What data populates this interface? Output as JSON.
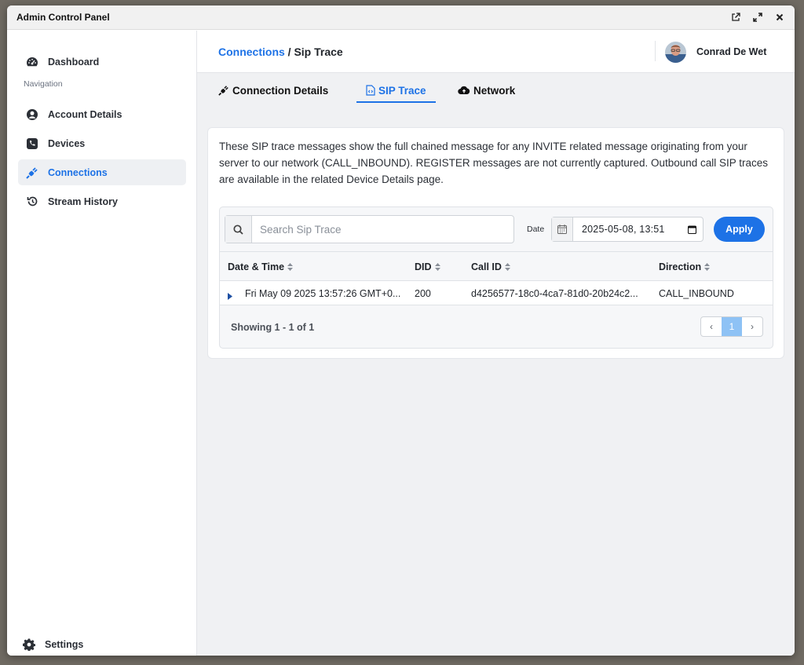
{
  "window": {
    "title": "Admin Control Panel"
  },
  "sidebar": {
    "section_label": "Navigation",
    "items": [
      {
        "label": "Dashboard",
        "icon": "gauge-icon"
      },
      {
        "label": "Account Details",
        "icon": "user-circle-icon"
      },
      {
        "label": "Devices",
        "icon": "phone-icon"
      },
      {
        "label": "Connections",
        "icon": "plug-icon",
        "active": true
      },
      {
        "label": "Stream History",
        "icon": "history-icon"
      }
    ],
    "settings_label": "Settings"
  },
  "header": {
    "breadcrumb_link": "Connections",
    "breadcrumb_sep": " / ",
    "breadcrumb_current": "Sip Trace",
    "user_name": "Conrad De Wet"
  },
  "tabs": [
    {
      "label": "Connection Details",
      "icon": "plug-icon"
    },
    {
      "label": "SIP Trace",
      "icon": "file-code-icon",
      "active": true
    },
    {
      "label": "Network",
      "icon": "cloud-upload-icon"
    }
  ],
  "description": "These SIP trace messages show the full chained message for any INVITE related message originating from your server to our network (CALL_INBOUND). REGISTER messages are not currently captured. Outbound call SIP traces are available in the related Device Details page.",
  "filters": {
    "search_placeholder": "Search Sip Trace",
    "date_label": "Date",
    "date_value": "2025-05-08, 13:51",
    "apply_label": "Apply"
  },
  "table": {
    "columns": [
      "Date & Time",
      "DID",
      "Call ID",
      "Direction"
    ],
    "rows": [
      {
        "datetime": "Fri May 09 2025 13:57:26 GMT+0...",
        "did": "200",
        "call_id": "d4256577-18c0-4ca7-81d0-20b24c2...",
        "direction": "CALL_INBOUND"
      }
    ]
  },
  "pagination": {
    "showing": "Showing 1 - 1 of 1",
    "prev": "‹",
    "current_page": "1",
    "next": "›"
  },
  "colors": {
    "accent": "#1d72e6",
    "page_active": "#8ec2f5"
  }
}
